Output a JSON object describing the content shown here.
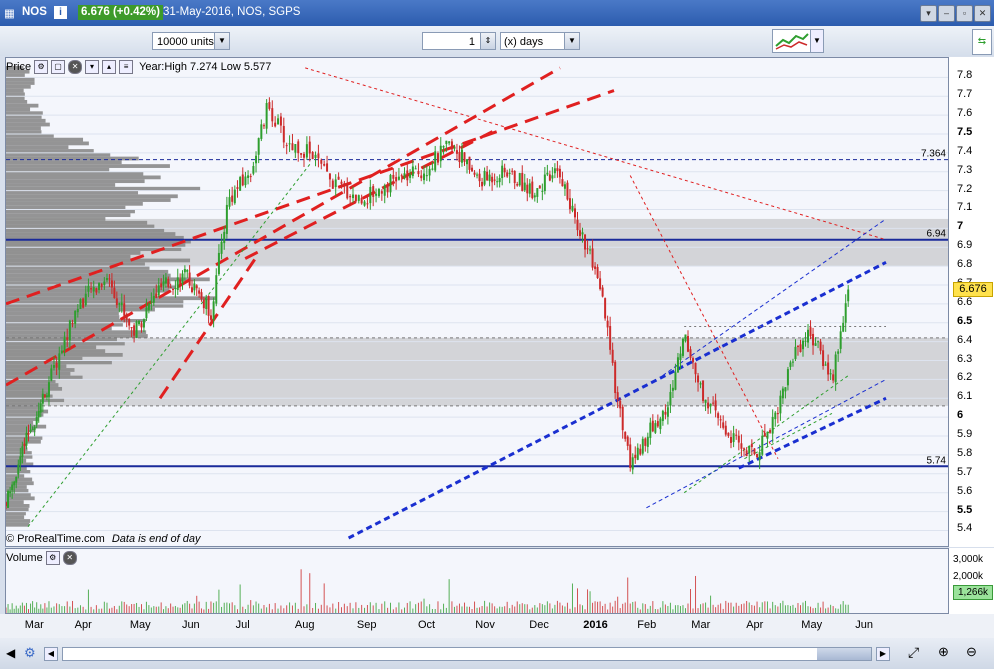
{
  "window": {
    "ticker": "NOS",
    "info_icon": "info-icon",
    "price_badge": "6.676 (+0.42%)",
    "title_rest": "31-May-2016, NOS, SGPS",
    "badge_color": "#3d9a2a"
  },
  "toolbar": {
    "units_value": "10000 units",
    "period_value": "1",
    "period_unit": "(x) days"
  },
  "price_panel": {
    "label": "Price",
    "year_info": "Year:High 7.274 Low 5.577",
    "watermark": "© ProRealTime.com",
    "watermark_note": "Data is end of day",
    "current_price": "6.676",
    "level_labels": [
      "7.364",
      "6.94",
      "5.74"
    ]
  },
  "volume_panel": {
    "label": "Volume",
    "current_volume": "1,266k",
    "axis_labels": [
      "3,000k",
      "2,000k",
      "1,000k"
    ]
  },
  "colors": {
    "up": "#2e9e2e",
    "down": "#cc2a2a",
    "trend_red": "#e02020",
    "trend_blue": "#1a2fd0",
    "hline_blue": "#1a2a9a",
    "zone": "#c8c8cc",
    "profile": "#8a8a8a",
    "badge_green": "#3d9a2a"
  },
  "chart_data": {
    "type": "candlestick",
    "title": "NOS, SGPS",
    "x_ticks": [
      "Mar",
      "Apr",
      "May",
      "Jun",
      "Jul",
      "Aug",
      "Sep",
      "Oct",
      "Nov",
      "Dec",
      "2016",
      "Feb",
      "Mar",
      "Apr",
      "May",
      "Jun"
    ],
    "y_ticks": [
      "7.8",
      "7.7",
      "7.6",
      "7.5",
      "7.4",
      "7.3",
      "7.2",
      "7.1",
      "7",
      "6.9",
      "6.8",
      "6.7",
      "6.6",
      "6.5",
      "6.4",
      "6.3",
      "6.2",
      "6.1",
      "6",
      "5.9",
      "5.8",
      "5.7",
      "5.6",
      "5.5",
      "5.4"
    ],
    "ylim": [
      5.36,
      7.86
    ],
    "close_path": {
      "months": [
        0,
        0.5,
        1,
        1.5,
        2,
        2.5,
        3,
        3.5,
        4,
        4.3,
        4.7,
        5,
        5.3,
        5.7,
        6,
        6.5,
        7,
        7.5,
        8,
        8.5,
        9,
        9.5,
        10,
        10.2,
        10.5,
        10.8,
        11,
        11.3,
        11.6,
        12,
        12.3,
        12.6,
        13,
        13.3,
        13.6,
        14,
        14.3,
        14.6,
        15,
        15.3
      ],
      "price": [
        5.55,
        5.9,
        6.2,
        6.6,
        6.75,
        6.45,
        6.68,
        6.75,
        6.55,
        7.15,
        7.3,
        7.65,
        7.45,
        7.4,
        7.25,
        7.15,
        7.25,
        7.3,
        7.45,
        7.25,
        7.3,
        7.2,
        7.3,
        7.1,
        6.9,
        6.6,
        6.2,
        5.75,
        5.9,
        6.05,
        6.45,
        6.15,
        5.95,
        5.85,
        5.8,
        6.05,
        6.35,
        6.45,
        6.2,
        6.676
      ]
    },
    "levels": [
      7.364,
      6.94,
      5.74
    ],
    "volume_ylim": [
      0,
      3200
    ]
  }
}
